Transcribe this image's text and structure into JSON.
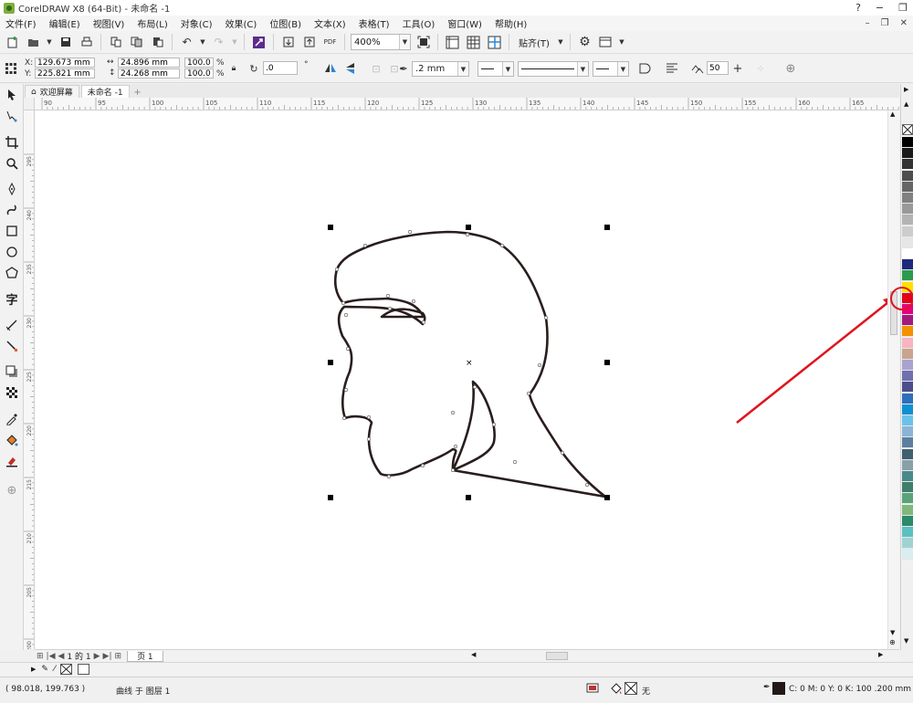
{
  "window": {
    "title": "CorelDRAW X8 (64-Bit) - 未命名 -1",
    "controls": [
      "?",
      "−",
      "❐"
    ]
  },
  "menu": {
    "items": [
      "文件(F)",
      "编辑(E)",
      "视图(V)",
      "布局(L)",
      "对象(C)",
      "效果(C)",
      "位图(B)",
      "文本(X)",
      "表格(T)",
      "工具(O)",
      "窗口(W)",
      "帮助(H)"
    ]
  },
  "toolbar": {
    "zoom": "400%",
    "snap_label": "贴齐(T)",
    "pdf_label": "PDF"
  },
  "property_bar": {
    "x_label": "X:",
    "x_value": "129.673 mm",
    "y_label": "Y:",
    "y_value": "225.821 mm",
    "width_value": "24.896 mm",
    "height_value": "24.268 mm",
    "scale_x": "100.0",
    "scale_y": "100.0",
    "percent": "%",
    "rotation": ".0",
    "outline_width": ".2 mm",
    "smoothing": "50"
  },
  "doc_tabs": {
    "home_label": "欢迎屏幕",
    "doc_label": "未命名 -1",
    "add": "+"
  },
  "ruler": {
    "h_ticks": [
      "90",
      "95",
      "100",
      "105",
      "110",
      "115",
      "120",
      "125",
      "130",
      "135",
      "140",
      "145",
      "150",
      "155",
      "160",
      "165"
    ],
    "v_ticks": [
      "295",
      "240",
      "235",
      "230",
      "225",
      "220",
      "215",
      "210",
      "205",
      "200"
    ]
  },
  "page_nav": {
    "page_text": "1 的 1",
    "page_tab": "页 1"
  },
  "status": {
    "coords": "( 98.018, 199.763 )",
    "object_info": "曲线 于 图层 1",
    "fill_none": "无",
    "outline_info": "C: 0 M: 0 Y: 0 K: 100  .200 mm"
  },
  "palette": {
    "colors": [
      "#000000",
      "#1a1a1a",
      "#333333",
      "#4d4d4d",
      "#666666",
      "#808080",
      "#999999",
      "#b3b3b3",
      "#cccccc",
      "#e6e6e6",
      "#ffffff",
      "#1d2a7c",
      "#2c9a4c",
      "#ffe000",
      "#e2001a",
      "#e5007e",
      "#a3197d",
      "#f39200",
      "#f7b4c1",
      "#c9a58e",
      "#a9a3cf",
      "#6f70ad",
      "#4e4d8c",
      "#2e6fba",
      "#0f90d2",
      "#6cc1ea",
      "#8cb4d6",
      "#5d7f9e",
      "#3e6070",
      "#8aa0a8",
      "#4a8a8a",
      "#3e7f6c",
      "#5aa37a",
      "#7fb87a",
      "#2a8a6a",
      "#5bc0c0",
      "#9fd3d3",
      "#d9eef0"
    ]
  }
}
